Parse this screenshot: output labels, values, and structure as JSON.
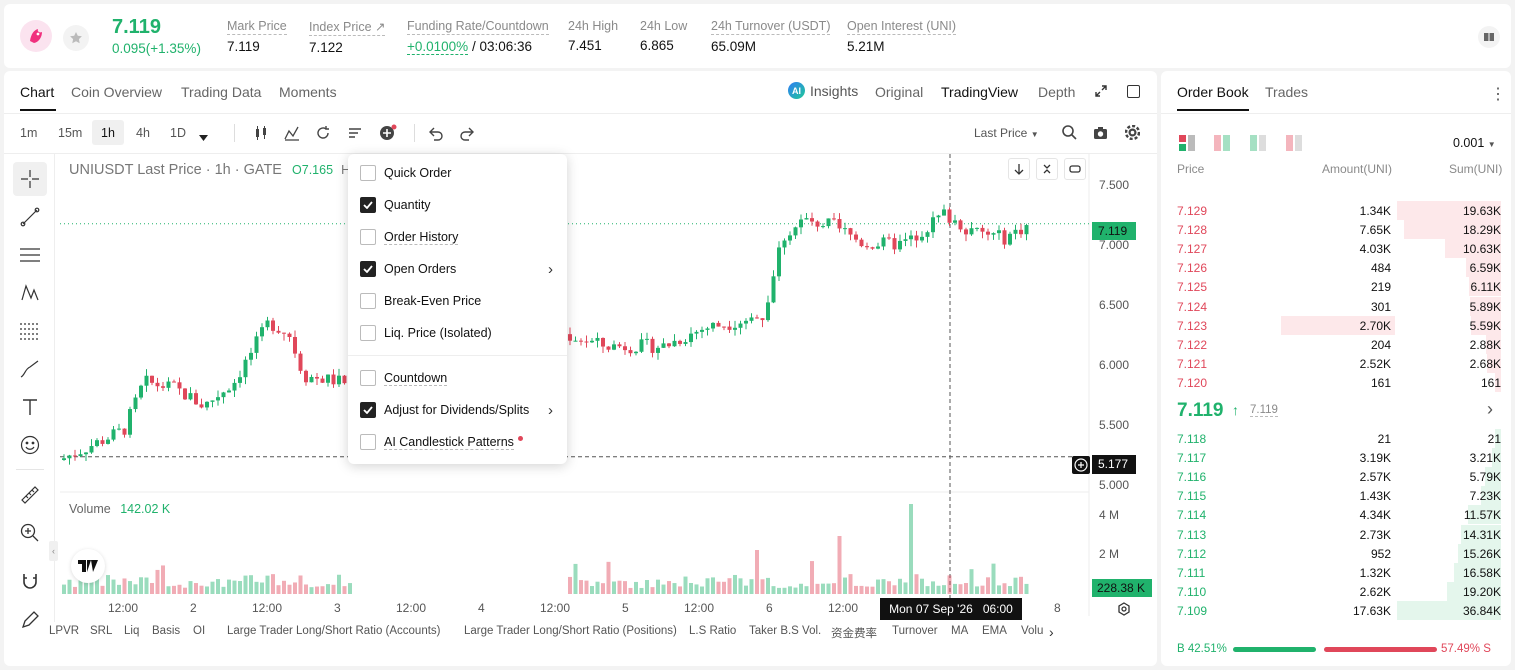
{
  "ticker": {
    "last": "7.119",
    "change": "0.095(+1.35%)",
    "stats": [
      {
        "label": "Mark Price",
        "value": "7.119"
      },
      {
        "label": "Index Price ↗",
        "value": "7.122"
      },
      {
        "label": "Funding Rate/Countdown",
        "value": "+0.0100%",
        "value2": "/ 03:06:36"
      },
      {
        "label": "24h High",
        "value": "7.451"
      },
      {
        "label": "24h Low",
        "value": "6.865"
      },
      {
        "label": "24h Turnover (USDT)",
        "value": "65.09M"
      },
      {
        "label": "Open Interest (UNI)",
        "value": "5.21M"
      }
    ]
  },
  "chart_tabs": [
    "Chart",
    "Coin Overview",
    "Trading Data",
    "Moments"
  ],
  "view_tabs": {
    "insights": "Insights",
    "original": "Original",
    "tradingview": "TradingView",
    "depth": "Depth"
  },
  "intervals": [
    "1m",
    "15m",
    "1h",
    "4h",
    "1D"
  ],
  "price_type": "Last Price",
  "legend": {
    "symbol": "UNIUSDT Last Price · 1h · GATE",
    "open": "O7.165",
    "h": "H"
  },
  "menu": {
    "items": [
      {
        "label": "Quick Order",
        "checked": false,
        "arrow": false
      },
      {
        "label": "Quantity",
        "checked": true,
        "arrow": false
      },
      {
        "label": "Order History",
        "checked": false,
        "arrow": false
      },
      {
        "label": "Open Orders",
        "checked": true,
        "arrow": true
      },
      {
        "label": "Break-Even Price",
        "checked": false,
        "arrow": false
      },
      {
        "label": "Liq. Price (Isolated)",
        "checked": false,
        "arrow": false
      },
      {
        "label": "Countdown",
        "checked": false,
        "arrow": false
      },
      {
        "label": "Adjust for Dividends/Splits",
        "checked": true,
        "arrow": true
      },
      {
        "label": "AI Candlestick Patterns",
        "checked": false,
        "arrow": false
      }
    ]
  },
  "price_axis": [
    "7.500",
    "7.000",
    "6.500",
    "6.000",
    "5.500",
    "5.000"
  ],
  "last_price_tag": "7.119",
  "cursor_price_tag": "5.177",
  "volume": {
    "label": "Volume",
    "value": "142.02 K",
    "axis": [
      "4 M",
      "2 M"
    ],
    "tag": "228.38 K"
  },
  "time_axis": [
    "12:00",
    "2",
    "12:00",
    "3",
    "12:00",
    "4",
    "12:00",
    "5",
    "12:00",
    "6",
    "12:00",
    "7",
    "8"
  ],
  "crosshair_time": "Mon 07 Sep '26   06:00",
  "indicators": [
    "LPVR",
    "SRL",
    "Liq",
    "Basis",
    "OI",
    "Large Trader Long/Short Ratio (Accounts)",
    "Large Trader Long/Short Ratio (Positions)",
    "L.S Ratio",
    "Taker B.S Vol.",
    "资金费率",
    "Turnover",
    "MA",
    "EMA",
    "Volu"
  ],
  "orderbook": {
    "tabs": [
      "Order Book",
      "Trades"
    ],
    "precision": "0.001",
    "headers": [
      "Price",
      "Amount(UNI)",
      "Sum(UNI)"
    ],
    "asks": [
      [
        "7.129",
        "1.34K",
        "19.63K"
      ],
      [
        "7.128",
        "7.65K",
        "18.29K"
      ],
      [
        "7.127",
        "4.03K",
        "10.63K"
      ],
      [
        "7.126",
        "484",
        "6.59K"
      ],
      [
        "7.125",
        "219",
        "6.11K"
      ],
      [
        "7.124",
        "301",
        "5.89K"
      ],
      [
        "7.123",
        "2.70K",
        "5.59K"
      ],
      [
        "7.122",
        "204",
        "2.88K"
      ],
      [
        "7.121",
        "2.52K",
        "2.68K"
      ],
      [
        "7.120",
        "161",
        "161"
      ]
    ],
    "mid": "7.119",
    "mid_ref": "7.119",
    "bids": [
      [
        "7.118",
        "21",
        "21"
      ],
      [
        "7.117",
        "3.19K",
        "3.21K"
      ],
      [
        "7.116",
        "2.57K",
        "5.79K"
      ],
      [
        "7.115",
        "1.43K",
        "7.23K"
      ],
      [
        "7.114",
        "4.34K",
        "11.57K"
      ],
      [
        "7.113",
        "2.73K",
        "14.31K"
      ],
      [
        "7.112",
        "952",
        "15.26K"
      ],
      [
        "7.111",
        "1.32K",
        "16.58K"
      ],
      [
        "7.110",
        "2.62K",
        "19.20K"
      ],
      [
        "7.109",
        "17.63K",
        "36.84K"
      ]
    ],
    "buy_pct": "B 42.51%",
    "sell_pct": "57.49% S",
    "buy_ratio": 0.4251
  },
  "colors": {
    "up": "#20b26c",
    "down": "#e0475a"
  }
}
